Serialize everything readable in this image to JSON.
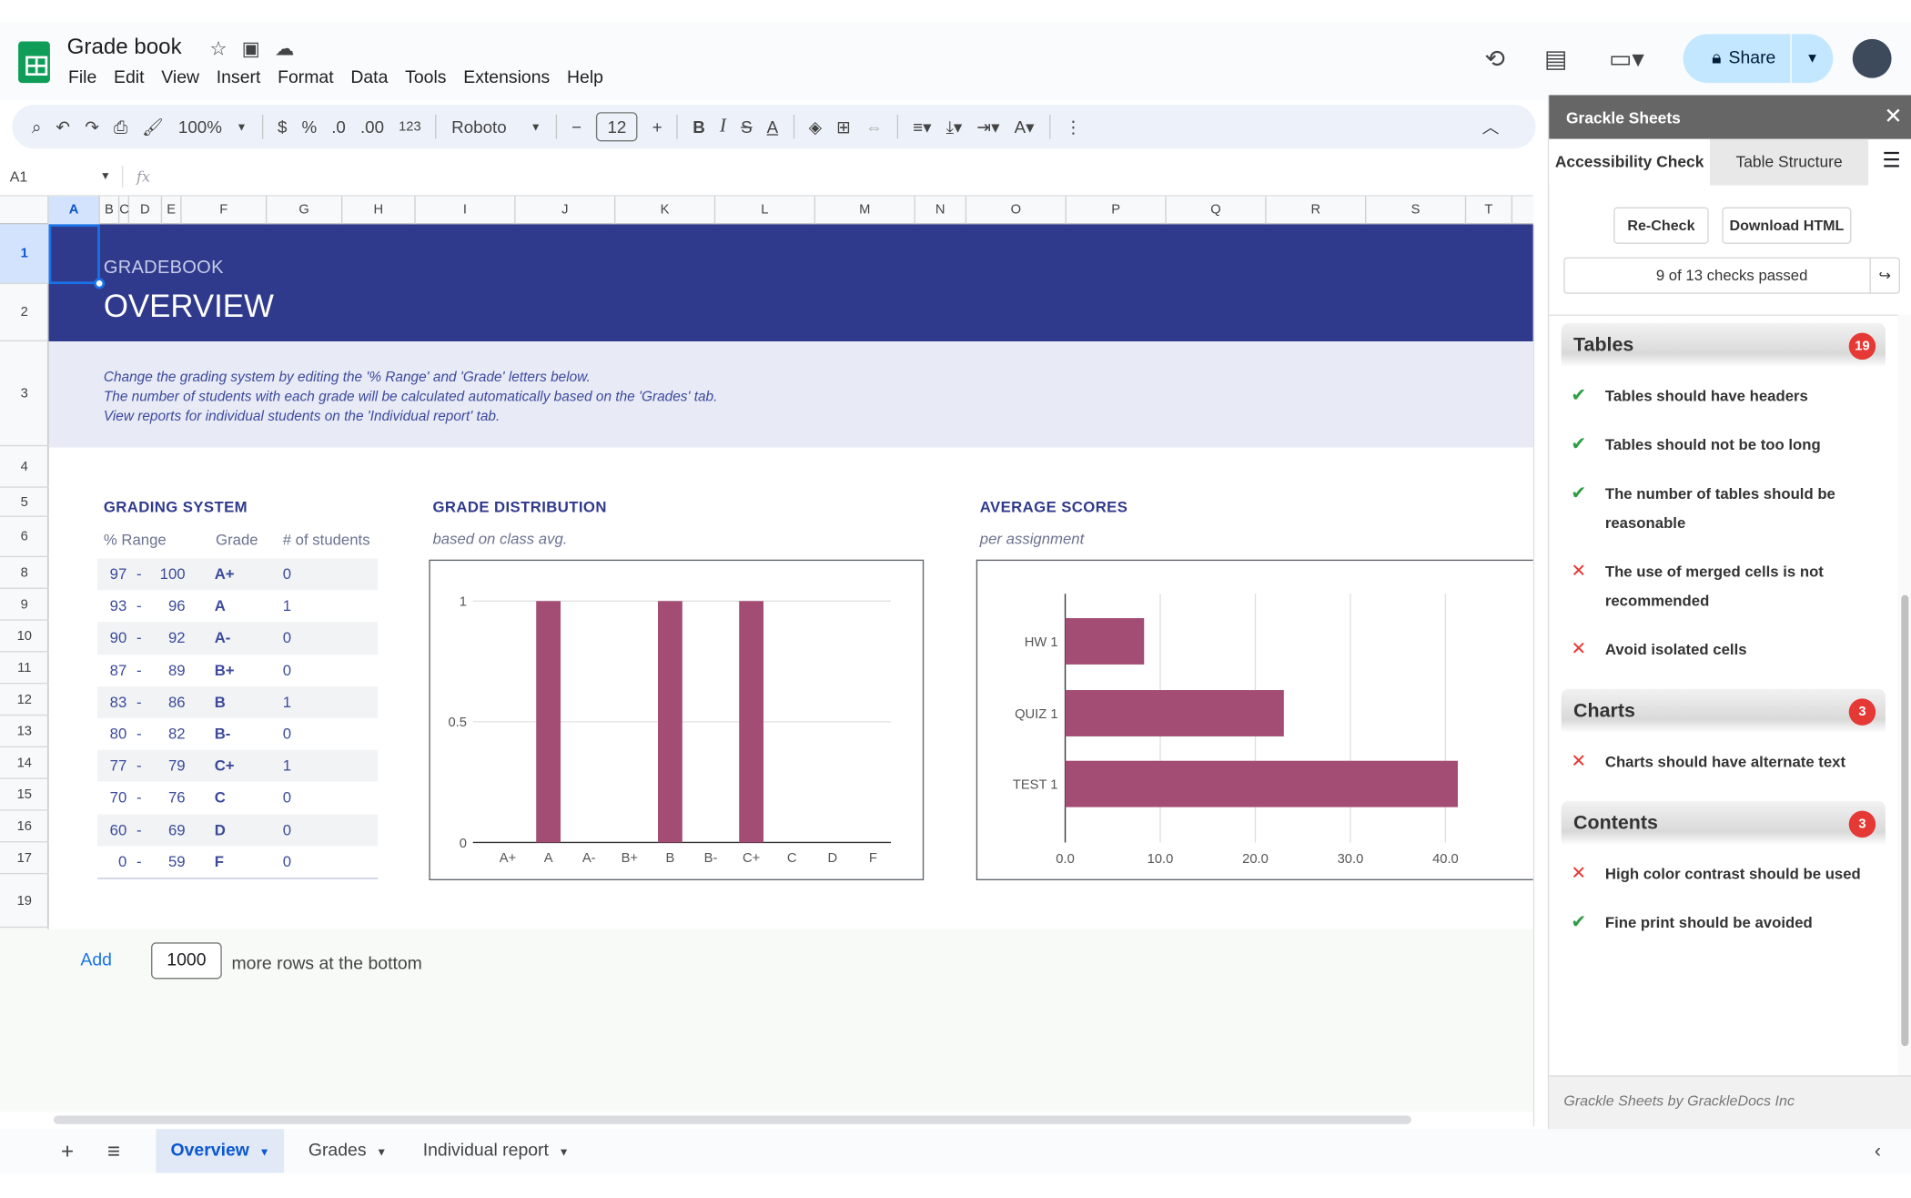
{
  "app": {
    "doc_title": "Grade book",
    "menu": [
      "File",
      "Edit",
      "View",
      "Insert",
      "Format",
      "Data",
      "Tools",
      "Extensions",
      "Help"
    ],
    "share_label": "Share"
  },
  "toolbar": {
    "zoom": "100%",
    "currency": "$",
    "percent": "%",
    "dec_less": ".0",
    "dec_more": ".00",
    "number_format": "123",
    "font": "Roboto",
    "font_size": "12",
    "bold": "B",
    "italic": "I",
    "strike": "S",
    "text_color": "A"
  },
  "formula_bar": {
    "name_box": "A1",
    "fx": "fx"
  },
  "grid": {
    "columns": [
      "A",
      "B",
      "C",
      "D",
      "E",
      "F",
      "G",
      "H",
      "I",
      "J",
      "K",
      "L",
      "M",
      "N",
      "O",
      "P",
      "Q",
      "R",
      "S",
      "T"
    ],
    "rows": [
      "1",
      "2",
      "3",
      "4",
      "5",
      "6",
      "8",
      "9",
      "10",
      "11",
      "12",
      "13",
      "14",
      "15",
      "16",
      "17",
      "19"
    ]
  },
  "sheet": {
    "header_sub": "GRADEBOOK",
    "header_main": "OVERVIEW",
    "info_lines": [
      "Change the grading system by editing the '% Range' and 'Grade' letters below.",
      "The number of students with each grade will be calculated automatically based on the 'Grades' tab.",
      "View reports for individual students on the 'Individual report' tab."
    ],
    "grading_system": {
      "title": "GRADING SYSTEM",
      "headers": [
        "% Range",
        "Grade",
        "# of students"
      ],
      "rows": [
        {
          "lo": "97",
          "hi": "100",
          "grade": "A+",
          "n": "0"
        },
        {
          "lo": "93",
          "hi": "96",
          "grade": "A",
          "n": "1"
        },
        {
          "lo": "90",
          "hi": "92",
          "grade": "A-",
          "n": "0"
        },
        {
          "lo": "87",
          "hi": "89",
          "grade": "B+",
          "n": "0"
        },
        {
          "lo": "83",
          "hi": "86",
          "grade": "B",
          "n": "1"
        },
        {
          "lo": "80",
          "hi": "82",
          "grade": "B-",
          "n": "0"
        },
        {
          "lo": "77",
          "hi": "79",
          "grade": "C+",
          "n": "1"
        },
        {
          "lo": "70",
          "hi": "76",
          "grade": "C",
          "n": "0"
        },
        {
          "lo": "60",
          "hi": "69",
          "grade": "D",
          "n": "0"
        },
        {
          "lo": "0",
          "hi": "59",
          "grade": "F",
          "n": "0"
        }
      ],
      "dash": "-"
    },
    "grade_dist_title": "GRADE DISTRIBUTION",
    "grade_dist_sub": "based on class avg.",
    "avg_scores_title": "AVERAGE SCORES",
    "avg_scores_sub": "per assignment",
    "add_rows": {
      "link": "Add",
      "value": "1000",
      "text": "more rows at the bottom"
    }
  },
  "chart_data": [
    {
      "type": "bar",
      "categories": [
        "A+",
        "A",
        "A-",
        "B+",
        "B",
        "B-",
        "C+",
        "C",
        "D",
        "F"
      ],
      "values": [
        0,
        1,
        0,
        0,
        1,
        0,
        1,
        0,
        0,
        0
      ],
      "ylim": [
        0,
        1
      ],
      "yticks": [
        "0",
        "0.5",
        "1"
      ],
      "color": "#a34d74",
      "grid": true
    },
    {
      "type": "bar",
      "orientation": "horizontal",
      "categories": [
        "HW 1",
        "QUIZ 1",
        "TEST 1"
      ],
      "values": [
        8.3,
        23,
        41.3
      ],
      "xlim": [
        0,
        50
      ],
      "xticks": [
        "0.0",
        "10.0",
        "20.0",
        "30.0",
        "40.0",
        "5"
      ],
      "color": "#a34d74",
      "grid": true
    }
  ],
  "tabs": {
    "items": [
      "Overview",
      "Grades",
      "Individual report"
    ],
    "active": "Overview"
  },
  "panel": {
    "title": "Grackle Sheets",
    "tab_active": "Accessibility Check",
    "tab_inactive": "Table Structure",
    "recheck": "Re-Check",
    "download": "Download HTML",
    "summary": "9 of 13 checks passed",
    "categories": [
      {
        "name": "Tables",
        "badge": "19",
        "checks": [
          {
            "text": "Tables should have headers",
            "status": "pass"
          },
          {
            "text": "Tables should not be too long",
            "status": "pass"
          },
          {
            "text": "The number of tables should be reasonable",
            "status": "pass"
          },
          {
            "text": "The use of merged cells is not recommended",
            "status": "fail"
          },
          {
            "text": "Avoid isolated cells",
            "status": "fail"
          }
        ]
      },
      {
        "name": "Charts",
        "badge": "3",
        "checks": [
          {
            "text": "Charts should have alternate text",
            "status": "fail"
          }
        ]
      },
      {
        "name": "Contents",
        "badge": "3",
        "checks": [
          {
            "text": "High color contrast should be used",
            "status": "fail"
          },
          {
            "text": "Fine print should be avoided",
            "status": "pass"
          }
        ]
      }
    ],
    "footer": "Grackle Sheets by GrackleDocs Inc"
  }
}
